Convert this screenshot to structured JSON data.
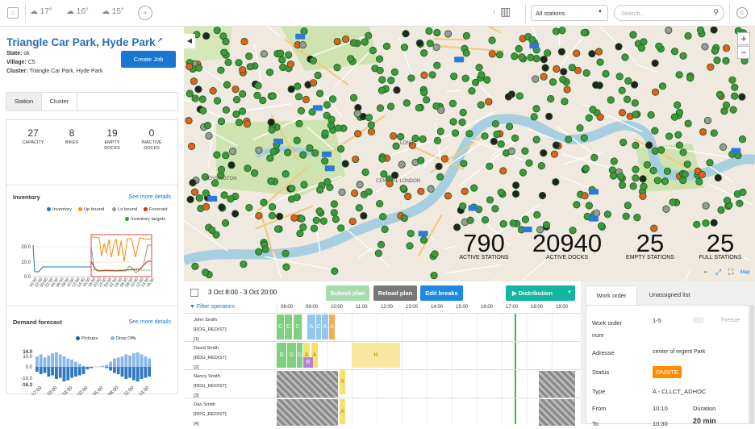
{
  "topbar": {
    "weather": [
      "17°",
      "16°",
      "15°"
    ],
    "station_filter": "All stations",
    "search_placeholder": "Search..."
  },
  "station": {
    "title": "Triangle Car Park, Hyde Park",
    "state_label": "State:",
    "state_value": "ok",
    "village_label": "Village:",
    "village_value": "C5",
    "cluster_label": "Cluster:",
    "cluster_value": "Triangle Car Park, Hyde Park",
    "create_job": "Create Job"
  },
  "tabs": [
    "Station",
    "Cluster"
  ],
  "stats": [
    {
      "value": "27",
      "label": "CAPACITY"
    },
    {
      "value": "8",
      "label": "BIKES"
    },
    {
      "value": "19",
      "label": "EMPTY DOCKS"
    },
    {
      "value": "0",
      "label": "INACTIVE DOCKS"
    }
  ],
  "inventory": {
    "title": "Inventory",
    "more": "See more details",
    "legend": [
      {
        "name": "Inventory",
        "color": "#1f77b4"
      },
      {
        "name": "Up bound",
        "color": "#ff8c00"
      },
      {
        "name": "Lo bound",
        "color": "#999999"
      },
      {
        "name": "Forecast",
        "color": "#d62728"
      },
      {
        "name": "Inventory targets",
        "color": "#2ca02c"
      }
    ],
    "yticks": [
      "20.0",
      "10.0",
      "0.0"
    ],
    "xticks": [
      "20:00",
      "22:00",
      "00:00",
      "02:00",
      "04:00",
      "06:00",
      "08:00",
      "10:00",
      "12:00",
      "14:00",
      "16:00",
      "18:00",
      "20:00",
      "22:00",
      "00:00",
      "02:00",
      "04:00",
      "06:00",
      "08:00",
      "10:00",
      "12:00",
      "14:00",
      "16:00"
    ]
  },
  "demand": {
    "title": "Demand forecast",
    "more": "See more details",
    "legend": [
      {
        "name": "Pickups",
        "color": "#1f5fa8"
      },
      {
        "name": "Drop Offs",
        "color": "#8ab8e6"
      }
    ],
    "yticks": [
      "14.0",
      "10.0",
      "0.0",
      "-10.0",
      "-16.3"
    ],
    "xticks": [
      "17:00",
      "20:00",
      "23:00",
      "02:00",
      "05:00",
      "08:00",
      "11:00",
      "14:00"
    ]
  },
  "map": {
    "stats": [
      {
        "value": "790",
        "label": "ACTIVE STATIONS"
      },
      {
        "value": "20940",
        "label": "ACTIVE DOCKS"
      },
      {
        "value": "25",
        "label": "EMPTY STATIONS"
      },
      {
        "value": "25",
        "label": "FULL STATIONS"
      }
    ],
    "labels": [
      "KENSINGTON",
      "CENTRAL LONDON",
      "LOND"
    ],
    "attribution": "Map"
  },
  "schedule": {
    "range": "3 Oct 8:00 - 3 Oct 20:00",
    "submit": "Submit plan",
    "reload": "Reload plan",
    "edit": "Edit breaks",
    "distribution": "Distribution",
    "filter": "Filter operators",
    "hours": [
      "08:00",
      "09:00",
      "10:00",
      "11:00",
      "12:00",
      "13:00",
      "14:00",
      "15:00",
      "16:00",
      "17:00",
      "18:00",
      "19:00"
    ],
    "operators": [
      {
        "name": "John Smith",
        "tag": "[RDG_REDIST]",
        "num": "[1]"
      },
      {
        "name": "David Smith",
        "tag": "[RDG_REDIST]",
        "num": "[2]"
      },
      {
        "name": "Nancy Smith",
        "tag": "[RDG_REDIST]",
        "num": "[3]"
      },
      {
        "name": "Dan Smith",
        "tag": "[RDG_REDIST]",
        "num": "[4]"
      }
    ],
    "block_letters": [
      "C",
      "C",
      "C",
      "A",
      "C",
      "A",
      "D",
      "D",
      "D",
      "A",
      "A",
      "B",
      "B",
      "D",
      "H",
      "A",
      "D",
      "A",
      "C"
    ]
  },
  "workorder": {
    "tab1": "Work order",
    "tab2": "Unassigned list",
    "freeze": "Freeze",
    "num_label": "Work order num",
    "num_value": "1-5",
    "address_label": "Adresse",
    "address_value": "center of regent Park",
    "status_label": "Status",
    "status_value": "ONSITE",
    "type_label": "Type",
    "type_value": "A - CLLCT_ADHOC",
    "from_label": "From",
    "from_value": "10:10",
    "to_label": "To",
    "to_value": "10:30",
    "duration_label": "Duration",
    "duration_value": "20 min"
  }
}
